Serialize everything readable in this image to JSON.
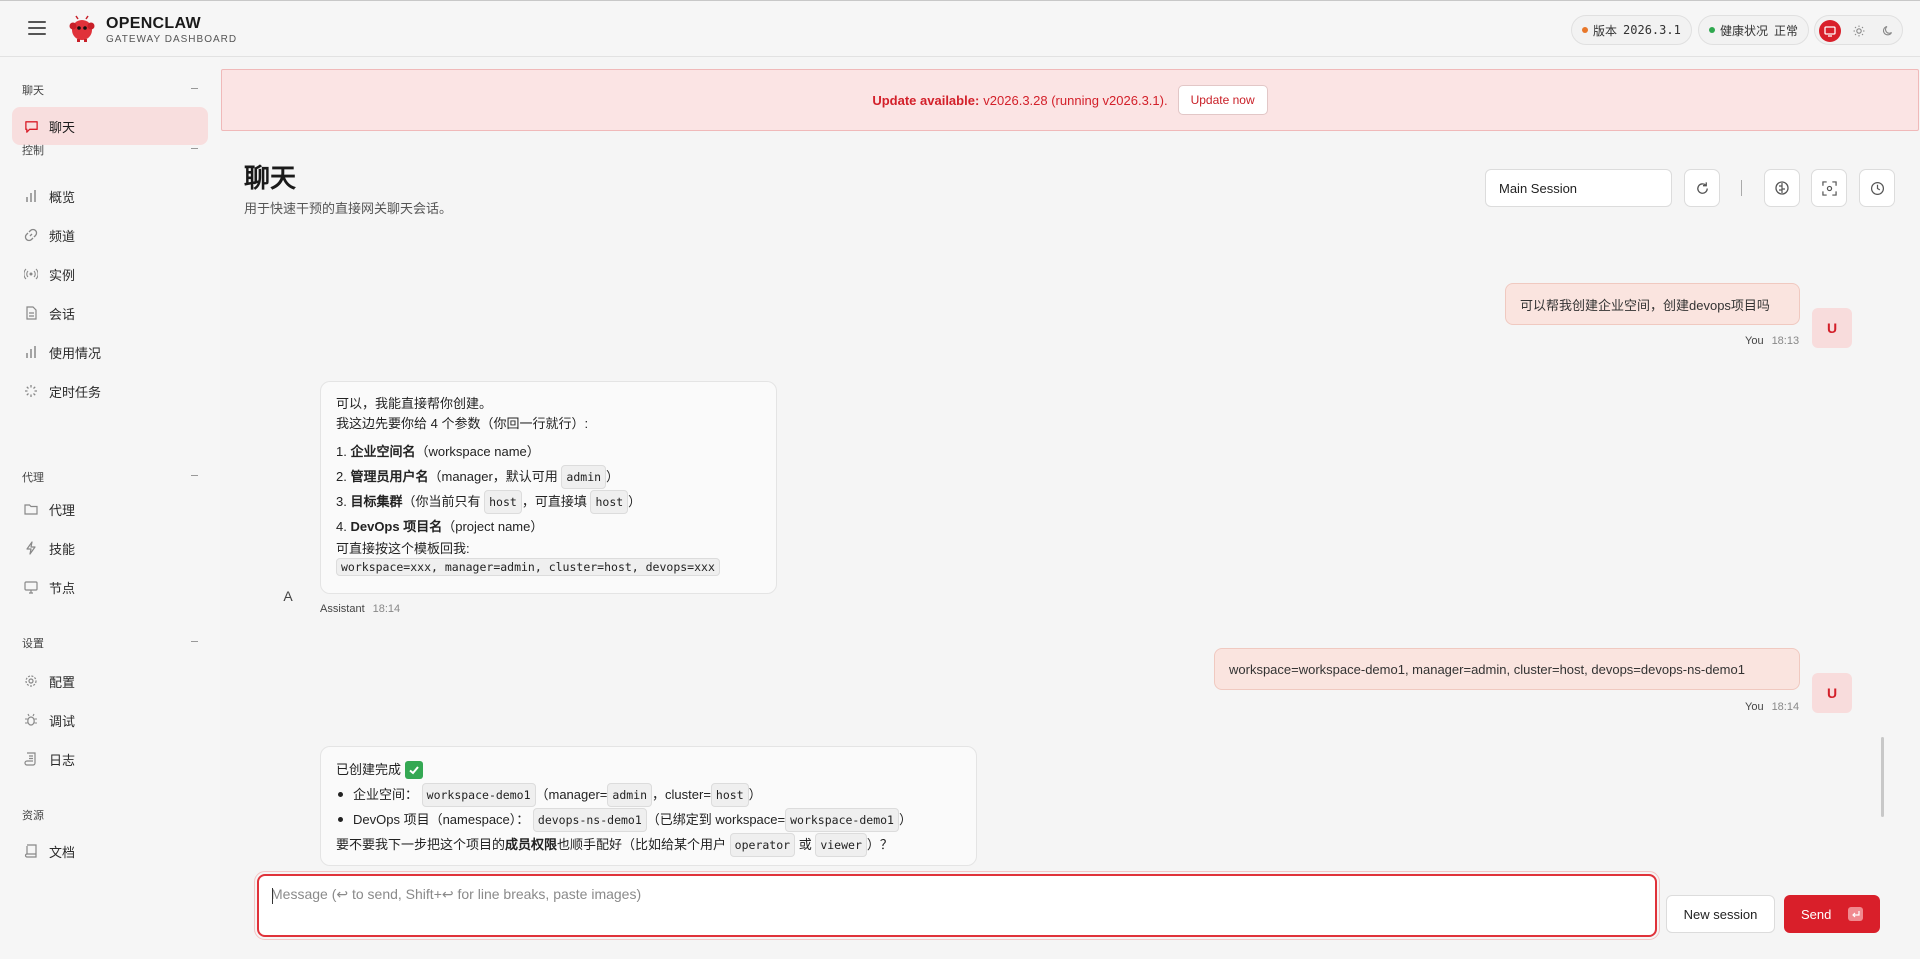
{
  "header": {
    "brand_title": "OPENCLAW",
    "brand_subtitle": "GATEWAY DASHBOARD",
    "version_label": "版本",
    "version_value": "2026.3.1",
    "health_label": "健康状况",
    "health_value": "正常",
    "colors": {
      "version_dot": "#e8772a",
      "health_dot": "#2fa84f",
      "accent": "#d91f2a"
    }
  },
  "sidebar": {
    "sections": [
      {
        "title": "聊天",
        "items": [
          {
            "label": "聊天",
            "icon": "message-icon",
            "active": true
          }
        ]
      },
      {
        "title": "控制",
        "items": [
          {
            "label": "概览",
            "icon": "bar-chart-icon"
          },
          {
            "label": "频道",
            "icon": "link-icon"
          },
          {
            "label": "实例",
            "icon": "radio-icon"
          },
          {
            "label": "会话",
            "icon": "file-icon"
          },
          {
            "label": "使用情况",
            "icon": "bar-chart-icon"
          },
          {
            "label": "定时任务",
            "icon": "loader-icon"
          }
        ]
      },
      {
        "title": "代理",
        "items": [
          {
            "label": "代理",
            "icon": "folder-icon"
          },
          {
            "label": "技能",
            "icon": "zap-icon"
          },
          {
            "label": "节点",
            "icon": "monitor-icon"
          }
        ]
      },
      {
        "title": "设置",
        "items": [
          {
            "label": "配置",
            "icon": "gear-icon"
          },
          {
            "label": "调试",
            "icon": "bug-icon"
          },
          {
            "label": "日志",
            "icon": "scroll-icon"
          }
        ]
      },
      {
        "title": "资源",
        "items": [
          {
            "label": "文档",
            "icon": "book-icon"
          }
        ]
      }
    ]
  },
  "banner": {
    "strong": "Update available:",
    "text": "v2026.3.28 (running v2026.3.1).",
    "button": "Update now"
  },
  "page": {
    "title": "聊天",
    "subtitle": "用于快速干预的直接网关聊天会话。",
    "session_value": "Main Session"
  },
  "messages": {
    "m1": {
      "text": "可以帮我创建企业空间，创建devops项目吗",
      "author": "You",
      "time": "18:13",
      "avatar": "U"
    },
    "m2": {
      "avatar": "A",
      "author": "Assistant",
      "time": "18:14",
      "intro1": "可以，我能直接帮你创建。",
      "intro2": "我这边先要你给 4 个参数（你回一行就行）:",
      "items": [
        {
          "num": "1.",
          "bold": "企业空间名",
          "rest": "（workspace name）"
        },
        {
          "num": "2.",
          "bold": "管理员用户名",
          "rest": "（manager，默认可用",
          "code": "admin",
          "tail": "）"
        },
        {
          "num": "3.",
          "bold": "目标集群",
          "rest": "（你当前只有",
          "code": "host",
          "mid": "，可直接填",
          "code2": "host",
          "tail": "）"
        },
        {
          "num": "4.",
          "bold": "DevOps 项目名",
          "rest": "（project name）"
        }
      ],
      "template_label": "可直接按这个模板回我:",
      "template_code": "workspace=xxx, manager=admin, cluster=host, devops=xxx"
    },
    "m3": {
      "text": "workspace=workspace-demo1, manager=admin, cluster=host, devops=devops-ns-demo1",
      "author": "You",
      "time": "18:14",
      "avatar": "U"
    },
    "m4": {
      "done": "已创建完成",
      "b1_label": "企业空间：",
      "b1_code": "workspace-demo1",
      "b1_a": "（manager=",
      "b1_code2": "admin",
      "b1_b": "，cluster=",
      "b1_code3": "host",
      "b1_c": "）",
      "b2_label": "DevOps 项目（namespace）：",
      "b2_code": "devops-ns-demo1",
      "b2_a": "（已绑定到 workspace=",
      "b2_code2": "workspace-demo1",
      "b2_b": "）",
      "q_a": "要不要我下一步把这个项目的",
      "q_bold": "成员权限",
      "q_b": "也顺手配好（比如给某个用户",
      "q_code": "operator",
      "q_c": "或",
      "q_code2": "viewer",
      "q_d": "）？"
    }
  },
  "composer": {
    "placeholder": "Message (↩ to send, Shift+↩ for line breaks, paste images)",
    "new_session": "New session",
    "send": "Send"
  }
}
